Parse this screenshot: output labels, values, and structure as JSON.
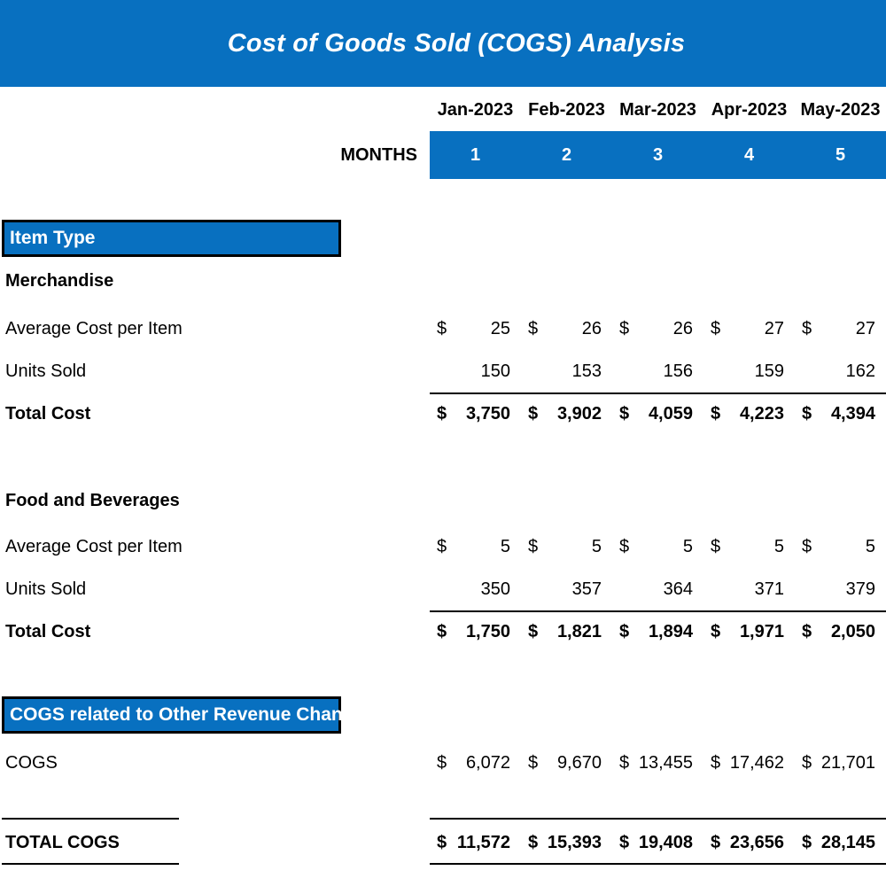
{
  "title": "Cost of Goods Sold (COGS) Analysis",
  "header": {
    "months_label": "MONTHS",
    "period_labels": [
      "Jan-2023",
      "Feb-2023",
      "Mar-2023",
      "Apr-2023",
      "May-2023"
    ],
    "month_numbers": [
      "1",
      "2",
      "3",
      "4",
      "5"
    ]
  },
  "colors": {
    "accent_blue": "#0870c0",
    "header_text": "#ffffff",
    "body_text": "#000000"
  },
  "sections": [
    {
      "box_label": "Item Type",
      "group_label": "Merchandise",
      "rows": [
        {
          "label": "Average Cost per Item",
          "currency": "$",
          "values": [
            "25",
            "26",
            "26",
            "27",
            "27"
          ],
          "bold": false
        },
        {
          "label": "Units Sold",
          "currency": "",
          "values": [
            "150",
            "153",
            "156",
            "159",
            "162"
          ],
          "bold": false
        },
        {
          "label": "Total Cost",
          "currency": "$",
          "values": [
            "3,750",
            "3,902",
            "4,059",
            "4,223",
            "4,394"
          ],
          "bold": true
        }
      ]
    },
    {
      "box_label": "",
      "group_label": "Food and Beverages",
      "rows": [
        {
          "label": "Average Cost per Item",
          "currency": "$",
          "values": [
            "5",
            "5",
            "5",
            "5",
            "5"
          ],
          "bold": false
        },
        {
          "label": "Units Sold",
          "currency": "",
          "values": [
            "350",
            "357",
            "364",
            "371",
            "379"
          ],
          "bold": false
        },
        {
          "label": "Total Cost",
          "currency": "$",
          "values": [
            "1,750",
            "1,821",
            "1,894",
            "1,971",
            "2,050"
          ],
          "bold": true
        }
      ]
    },
    {
      "box_label": "COGS related to Other Revenue Channels",
      "group_label": "",
      "rows": [
        {
          "label": "COGS",
          "currency": "$",
          "values": [
            "6,072",
            "9,670",
            "13,455",
            "17,462",
            "21,701"
          ],
          "bold": false
        }
      ]
    }
  ],
  "total": {
    "label": "TOTAL COGS",
    "currency": "$",
    "values": [
      "11,572",
      "15,393",
      "19,408",
      "23,656",
      "28,145"
    ]
  }
}
